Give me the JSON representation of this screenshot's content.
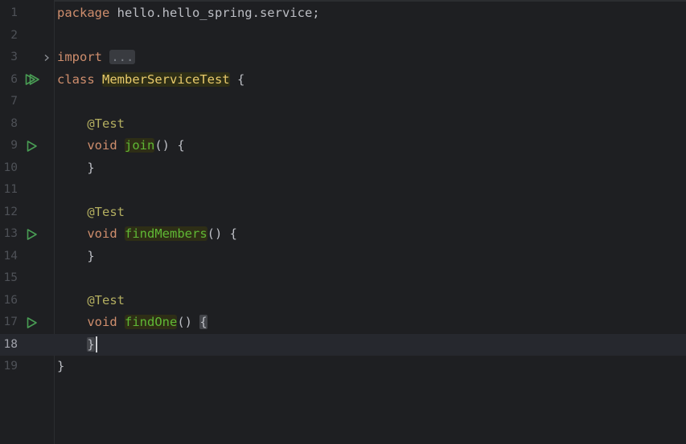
{
  "editor": {
    "current_line": 18,
    "lines": [
      {
        "num": "1",
        "tokens": [
          [
            "kw",
            "package "
          ],
          [
            "punct",
            "hello.hello_spring.service;"
          ]
        ]
      },
      {
        "num": "2",
        "tokens": []
      },
      {
        "num": "3",
        "fold": true,
        "tokens": [
          [
            "kw",
            "import "
          ],
          [
            "ellipsis",
            "..."
          ]
        ]
      },
      {
        "num": "6",
        "icon": "run-all",
        "tokens": [
          [
            "kw",
            "class "
          ],
          [
            "cls-hl",
            "MemberServiceTest"
          ],
          [
            "punct",
            " {"
          ]
        ]
      },
      {
        "num": "7",
        "tokens": []
      },
      {
        "num": "8",
        "tokens": [
          [
            "punct",
            "    "
          ],
          [
            "ann",
            "@Test"
          ]
        ]
      },
      {
        "num": "9",
        "icon": "run",
        "tokens": [
          [
            "punct",
            "    "
          ],
          [
            "kw",
            "void "
          ],
          [
            "fn-hl",
            "join"
          ],
          [
            "punct",
            "() {"
          ]
        ]
      },
      {
        "num": "10",
        "tokens": [
          [
            "punct",
            "    }"
          ]
        ]
      },
      {
        "num": "11",
        "tokens": []
      },
      {
        "num": "12",
        "tokens": [
          [
            "punct",
            "    "
          ],
          [
            "ann",
            "@Test"
          ]
        ]
      },
      {
        "num": "13",
        "icon": "run",
        "tokens": [
          [
            "punct",
            "    "
          ],
          [
            "kw",
            "void "
          ],
          [
            "fn-hl",
            "findMembers"
          ],
          [
            "punct",
            "() {"
          ]
        ]
      },
      {
        "num": "14",
        "tokens": [
          [
            "punct",
            "    }"
          ]
        ]
      },
      {
        "num": "15",
        "tokens": []
      },
      {
        "num": "16",
        "tokens": [
          [
            "punct",
            "    "
          ],
          [
            "ann",
            "@Test"
          ]
        ]
      },
      {
        "num": "17",
        "icon": "run",
        "tokens": [
          [
            "punct",
            "    "
          ],
          [
            "kw",
            "void "
          ],
          [
            "fn-hl",
            "findOne"
          ],
          [
            "punct",
            "() "
          ],
          [
            "brace",
            "{"
          ]
        ]
      },
      {
        "num": "18",
        "current": true,
        "tokens": [
          [
            "punct",
            "    "
          ],
          [
            "brace",
            "}"
          ],
          [
            "caret",
            ""
          ]
        ]
      },
      {
        "num": "19",
        "tokens": [
          [
            "punct",
            "}"
          ]
        ]
      }
    ]
  },
  "colors": {
    "background": "#1e1f22",
    "keyword": "#cf8e6d",
    "annotation": "#b3ae60",
    "class_name": "#e8ca6b",
    "method_name": "#5fb835",
    "run_icon": "#499c54"
  }
}
